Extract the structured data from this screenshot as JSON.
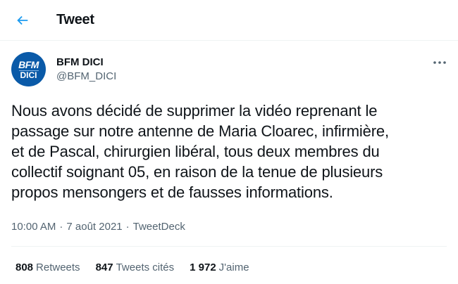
{
  "header": {
    "back_icon": "arrow-left-icon",
    "title": "Tweet",
    "accent_color": "#1d9bf0"
  },
  "author": {
    "avatar_logo_top": "BFM",
    "avatar_logo_bottom": "DICI",
    "avatar_color": "#0a5aa8",
    "display_name": "BFM DICI",
    "handle": "@BFM_DICI",
    "more_icon": "more-horizontal-icon"
  },
  "tweet": {
    "text": "Nous avons décidé de supprimer la vidéo reprenant le\npassage sur notre antenne de Maria Cloarec, infirmière,\net de Pascal, chirurgien libéral, tous deux membres du\ncollectif soignant 05, en raison de la tenue de plusieurs\npropos mensongers et de fausses informations.",
    "time": "10:00 AM",
    "separator": "·",
    "date": "7 août 2021",
    "source": "TweetDeck"
  },
  "stats": {
    "retweets_count": "808",
    "retweets_label": "Retweets",
    "quotes_count": "847",
    "quotes_label": "Tweets cités",
    "likes_count": "1 972",
    "likes_label": "J'aime"
  }
}
